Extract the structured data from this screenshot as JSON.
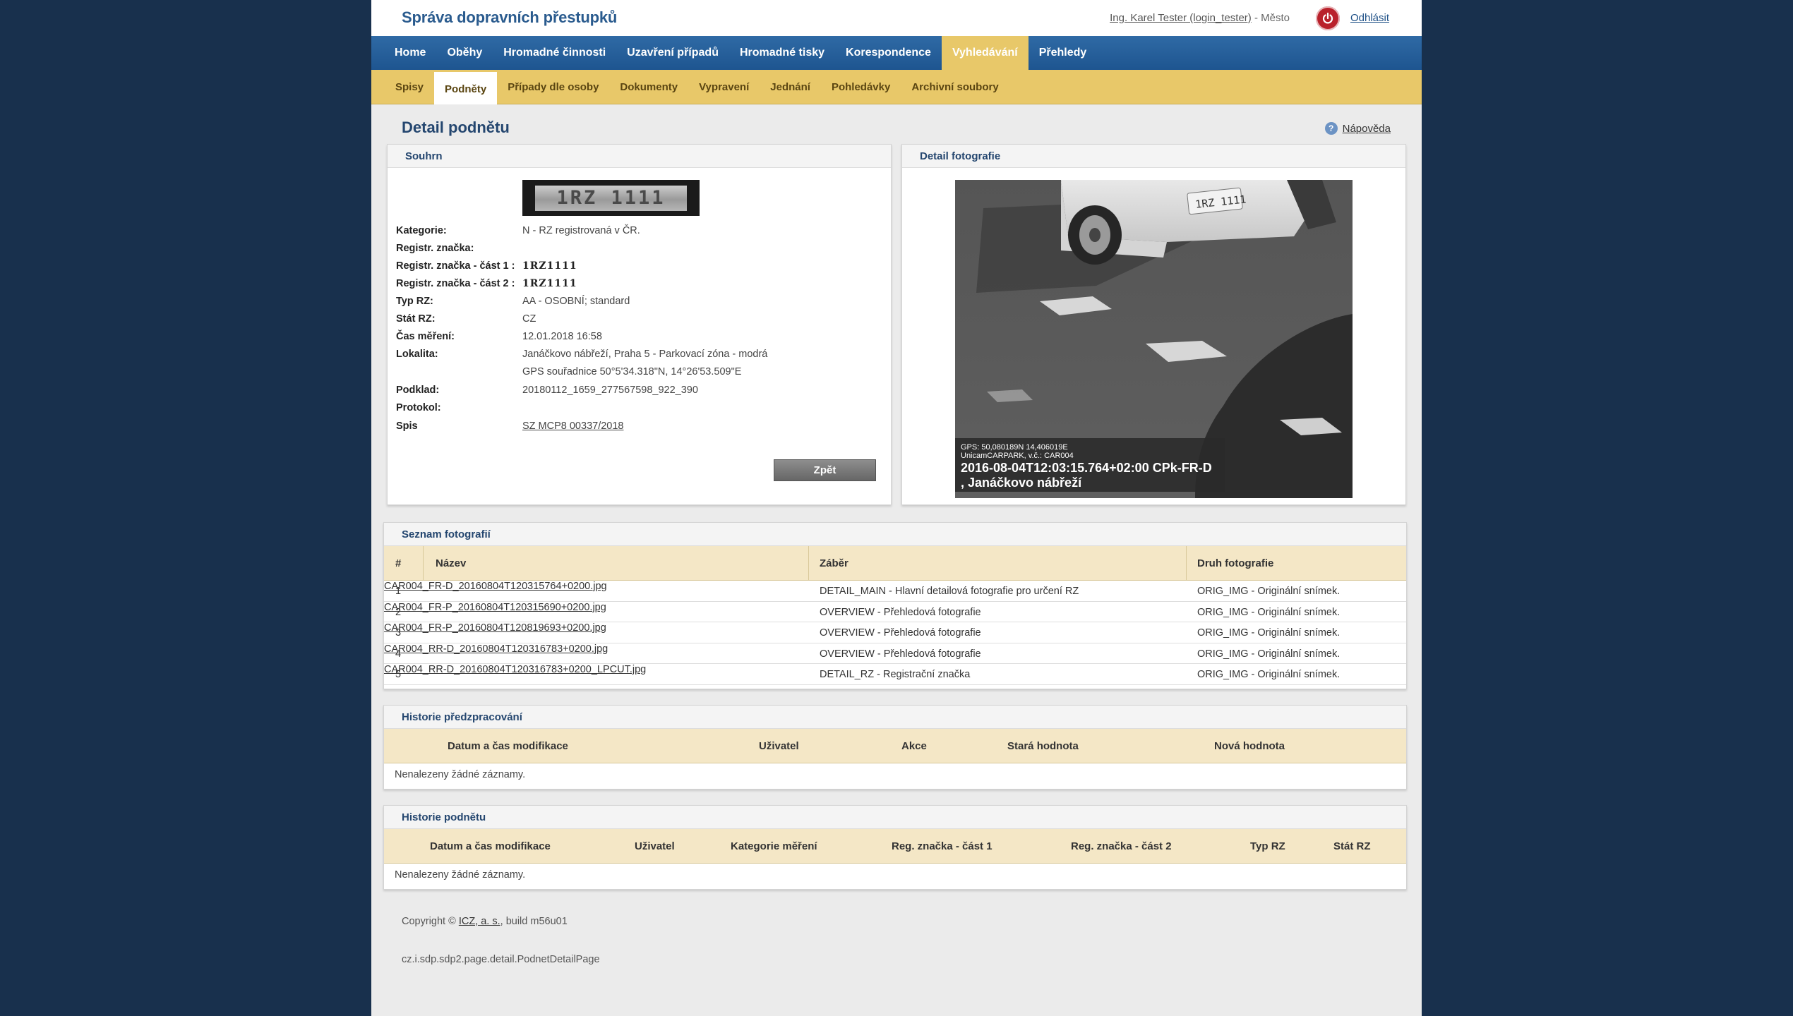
{
  "app": {
    "title": "Správa dopravních přestupků",
    "user": "Ing. Karel Tester (login_tester)",
    "user_separator": " - ",
    "user_scope": "Město",
    "logout": "Odhlásit"
  },
  "mainnav": [
    "Home",
    "Oběhy",
    "Hromadné činnosti",
    "Uzavření případů",
    "Hromadné tisky",
    "Korespondence",
    "Vyhledávání",
    "Přehledy"
  ],
  "subnav": [
    "Spisy",
    "Podněty",
    "Případy dle osoby",
    "Dokumenty",
    "Vypravení",
    "Jednání",
    "Pohledávky",
    "Archivní soubory"
  ],
  "page": {
    "title": "Detail podnětu",
    "help": "Nápověda"
  },
  "summary": {
    "title": "Souhrn",
    "plate_text": "1RZ 1111",
    "fields": [
      {
        "label": "Kategorie:",
        "value": "N - RZ registrovaná v ČR."
      },
      {
        "label": "Registr. značka:",
        "value": ""
      },
      {
        "label": "Registr. značka - část 1 :",
        "value": "1RZ1111"
      },
      {
        "label": "Registr. značka - část 2 :",
        "value": "1RZ1111"
      },
      {
        "label": "Typ RZ:",
        "value": "AA - OSOBNÍ; standard"
      },
      {
        "label": "Stát RZ:",
        "value": "CZ"
      },
      {
        "label": "Čas měření:",
        "value": "12.01.2018 16:58"
      },
      {
        "label": "Lokalita:",
        "value": "Janáčkovo nábřeží, Praha 5 - Parkovací zóna - modrá"
      },
      {
        "label": "",
        "value": "GPS souřadnice 50°5'34.318\"N, 14°26'53.509\"E"
      },
      {
        "label": "Podklad:",
        "value": "20180112_1659_277567598_922_390"
      },
      {
        "label": "Protokol:",
        "value": ""
      },
      {
        "label": "Spis",
        "value": "SZ MCP8 00337/2018"
      }
    ],
    "back": "Zpět"
  },
  "photo": {
    "title": "Detail fotografie",
    "plate_in_image": "1RZ 1111",
    "overlay_gps": "GPS: 50,080189N 14,406019E",
    "overlay_device": "UnicamCARPARK, v.č.: CAR004",
    "overlay_time": "2016-08-04T12:03:15.764+02:00 CPk-FR-D",
    "overlay_place": ", Janáčkovo nábřeží"
  },
  "photos_list": {
    "title": "Seznam fotografií",
    "headers": [
      "#",
      "Název",
      "Záběr",
      "Druh fotografie"
    ],
    "rows": [
      {
        "n": "1",
        "name": "CAR004_FR-D_20160804T120315764+0200.jpg",
        "shot": "DETAIL_MAIN - Hlavní detailová fotografie pro určení RZ",
        "kind": "ORIG_IMG - Originální snímek."
      },
      {
        "n": "2",
        "name": "CAR004_FR-P_20160804T120315690+0200.jpg",
        "shot": "OVERVIEW - Přehledová fotografie",
        "kind": "ORIG_IMG - Originální snímek."
      },
      {
        "n": "3",
        "name": "CAR004_FR-P_20160804T120819693+0200.jpg",
        "shot": "OVERVIEW - Přehledová fotografie",
        "kind": "ORIG_IMG - Originální snímek."
      },
      {
        "n": "4",
        "name": "CAR004_RR-D_20160804T120316783+0200.jpg",
        "shot": "OVERVIEW - Přehledová fotografie",
        "kind": "ORIG_IMG - Originální snímek."
      },
      {
        "n": "5",
        "name": "CAR004_RR-D_20160804T120316783+0200_LPCUT.jpg",
        "shot": "DETAIL_RZ - Registrační značka",
        "kind": "ORIG_IMG - Originální snímek."
      }
    ]
  },
  "predz": {
    "title": "Historie předzpracování",
    "headers": [
      "Datum a čas modifikace",
      "Uživatel",
      "Akce",
      "Stará hodnota",
      "Nová hodnota"
    ],
    "empty": "Nenalezeny žádné záznamy."
  },
  "histp": {
    "title": "Historie podnětu",
    "headers": [
      "Datum a čas modifikace",
      "Uživatel",
      "Kategorie měření",
      "Reg. značka - část 1",
      "Reg. značka - část 2",
      "Typ RZ",
      "Stát RZ"
    ],
    "empty": "Nenalezeny žádné záznamy."
  },
  "footer": {
    "copyright_prefix": "Copyright © ",
    "company": "ICZ, a. s.",
    "build": ", build m56u01",
    "page_class": "cz.i.sdp.sdp2.page.detail.PodnetDetailPage"
  },
  "colors": {
    "nav": "#1e5590",
    "subnav": "#e8c869",
    "background": "#18304d",
    "logout_icon": "#b9212b"
  }
}
